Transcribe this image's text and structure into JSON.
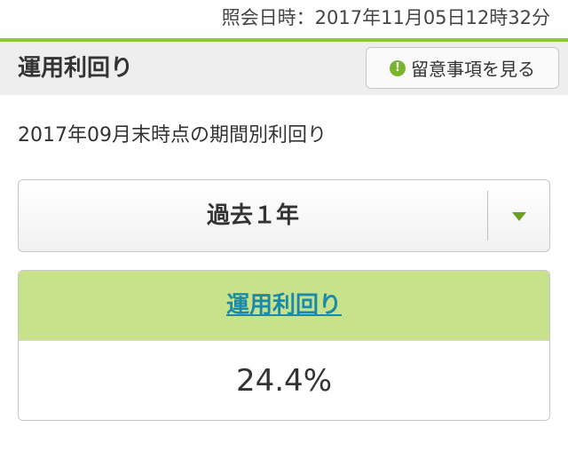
{
  "timestamp": "照会日時：2017年11月05日12時32分",
  "header": {
    "title": "運用利回り",
    "notice_button_label": "留意事項を見る",
    "notice_icon": "info-icon",
    "notice_icon_glyph": "!"
  },
  "period_caption": "2017年09月末時点の期間別利回り",
  "period_select": {
    "selected": "過去１年",
    "icon": "triangle-down-icon"
  },
  "yield_card": {
    "header_link": "運用利回り",
    "value": "24.4%"
  },
  "colors": {
    "accent": "#8cc63f",
    "card_header": "#c8e28b",
    "link": "#1a8aa8",
    "header_bg": "#eeeeee"
  }
}
